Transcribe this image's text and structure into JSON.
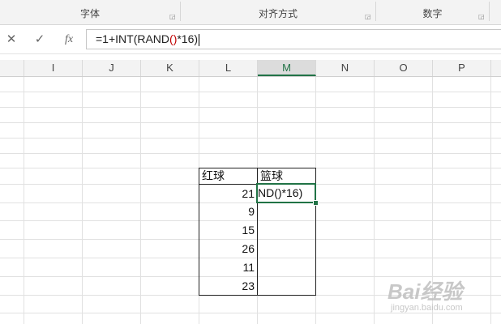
{
  "ribbon": {
    "groups": [
      {
        "label": "字体"
      },
      {
        "label": "对齐方式"
      },
      {
        "label": "数字"
      }
    ]
  },
  "formula_bar": {
    "cancel_icon": "✕",
    "enter_icon": "✓",
    "fx_label": "fx",
    "formula_before": "=1+INT(RAND",
    "formula_paren": "()",
    "formula_after": "*16)"
  },
  "columns": [
    "I",
    "J",
    "K",
    "L",
    "M",
    "N",
    "O",
    "P"
  ],
  "selected_column": "M",
  "table": {
    "header_l": "红球",
    "header_m": "篮球",
    "l_values": [
      "21",
      "9",
      "15",
      "26",
      "11",
      "23"
    ],
    "m_editing_text": "ND()*16)"
  },
  "watermark": {
    "logo_text": "Bai经验",
    "url_text": "jingyan.baidu.com"
  },
  "colors": {
    "accent": "#217346",
    "formula_paren": "#c00000"
  }
}
